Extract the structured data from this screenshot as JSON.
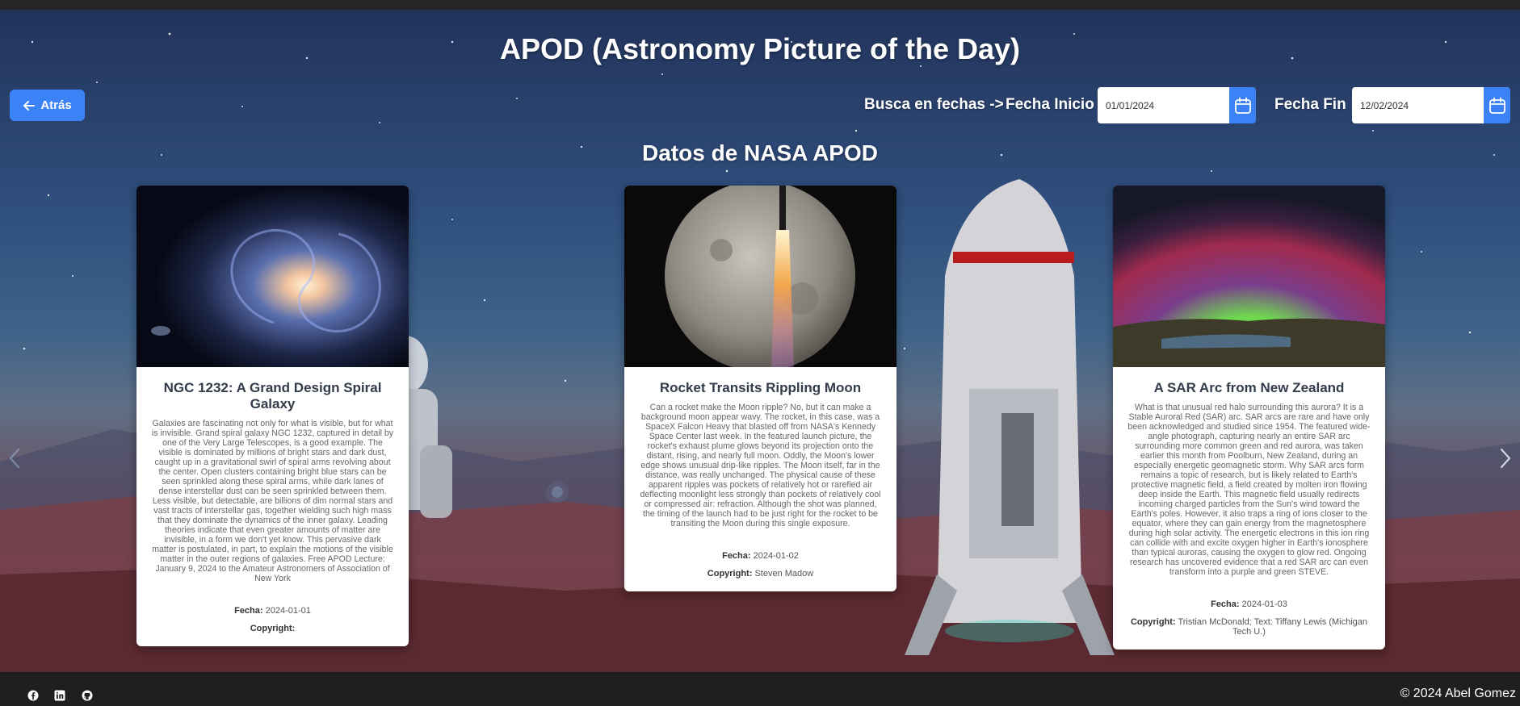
{
  "header": {
    "title": "APOD (Astronomy Picture of the Day)",
    "back_label": "Atrás"
  },
  "search": {
    "prefix": "Busca en fechas ->",
    "start_label": "Fecha Inicio",
    "start_value": "01/01/2024",
    "end_label": "Fecha Fin",
    "end_value": "12/02/2024"
  },
  "section_title": "Datos de NASA APOD",
  "labels": {
    "fecha": "Fecha:",
    "copyright": "Copyright:"
  },
  "cards": [
    {
      "title": "NGC 1232: A Grand Design Spiral Galaxy",
      "description": "Galaxies are fascinating not only for what is visible, but for what is invisible. Grand spiral galaxy NGC 1232, captured in detail by one of the Very Large Telescopes, is a good example. The visible is dominated by millions of bright stars and dark dust, caught up in a gravitational swirl of spiral arms revolving about the center. Open clusters containing bright blue stars can be seen sprinkled along these spiral arms, while dark lanes of dense interstellar dust can be seen sprinkled between them. Less visible, but detectable, are billions of dim normal stars and vast tracts of interstellar gas, together wielding such high mass that they dominate the dynamics of the inner galaxy. Leading theories indicate that even greater amounts of matter are invisible, in a form we don't yet know. This pervasive dark matter is postulated, in part, to explain the motions of the visible matter in the outer regions of galaxies. Free APOD Lecture: January 9, 2024 to the Amateur Astronomers of Association of New York",
      "date": "2024-01-01",
      "copyright": ""
    },
    {
      "title": "Rocket Transits Rippling Moon",
      "description": "Can a rocket make the Moon ripple? No, but it can make a background moon appear wavy. The rocket, in this case, was a SpaceX Falcon Heavy that blasted off from NASA's Kennedy Space Center last week. In the featured launch picture, the rocket's exhaust plume glows beyond its projection onto the distant, rising, and nearly full moon. Oddly, the Moon's lower edge shows unusual drip-like ripples. The Moon itself, far in the distance, was really unchanged. The physical cause of these apparent ripples was pockets of relatively hot or rarefied air deflecting moonlight less strongly than pockets of relatively cool or compressed air: refraction. Although the shot was planned, the timing of the launch had to be just right for the rocket to be transiting the Moon during this single exposure.",
      "date": "2024-01-02",
      "copyright": "Steven Madow"
    },
    {
      "title": "A SAR Arc from New Zealand",
      "description": "What is that unusual red halo surrounding this aurora? It is a Stable Auroral Red (SAR) arc. SAR arcs are rare and have only been acknowledged and studied since 1954. The featured wide-angle photograph, capturing nearly an entire SAR arc surrounding more common green and red aurora, was taken earlier this month from Poolburn, New Zealand, during an especially energetic geomagnetic storm. Why SAR arcs form remains a topic of research, but is likely related to Earth's protective magnetic field, a field created by molten iron flowing deep inside the Earth. This magnetic field usually redirects incoming charged particles from the Sun's wind toward the Earth's poles. However, it also traps a ring of ions closer to the equator, where they can gain energy from the magnetosphere during high solar activity. The energetic electrons in this ion ring can collide with and excite oxygen higher in Earth's ionosphere than typical auroras, causing the oxygen to glow red. Ongoing research has uncovered evidence that a red SAR arc can even transform into a purple and green STEVE.",
      "date": "2024-01-03",
      "copyright": "Tristian McDonald; Text: Tiffany Lewis (Michigan Tech U.)"
    }
  ],
  "footer": {
    "copyright": "© 2024 Abel Gomez",
    "social": [
      "facebook-icon",
      "linkedin-icon",
      "github-icon"
    ]
  },
  "colors": {
    "accent": "#3b82f6",
    "footer_bg": "#1f1f1f"
  }
}
